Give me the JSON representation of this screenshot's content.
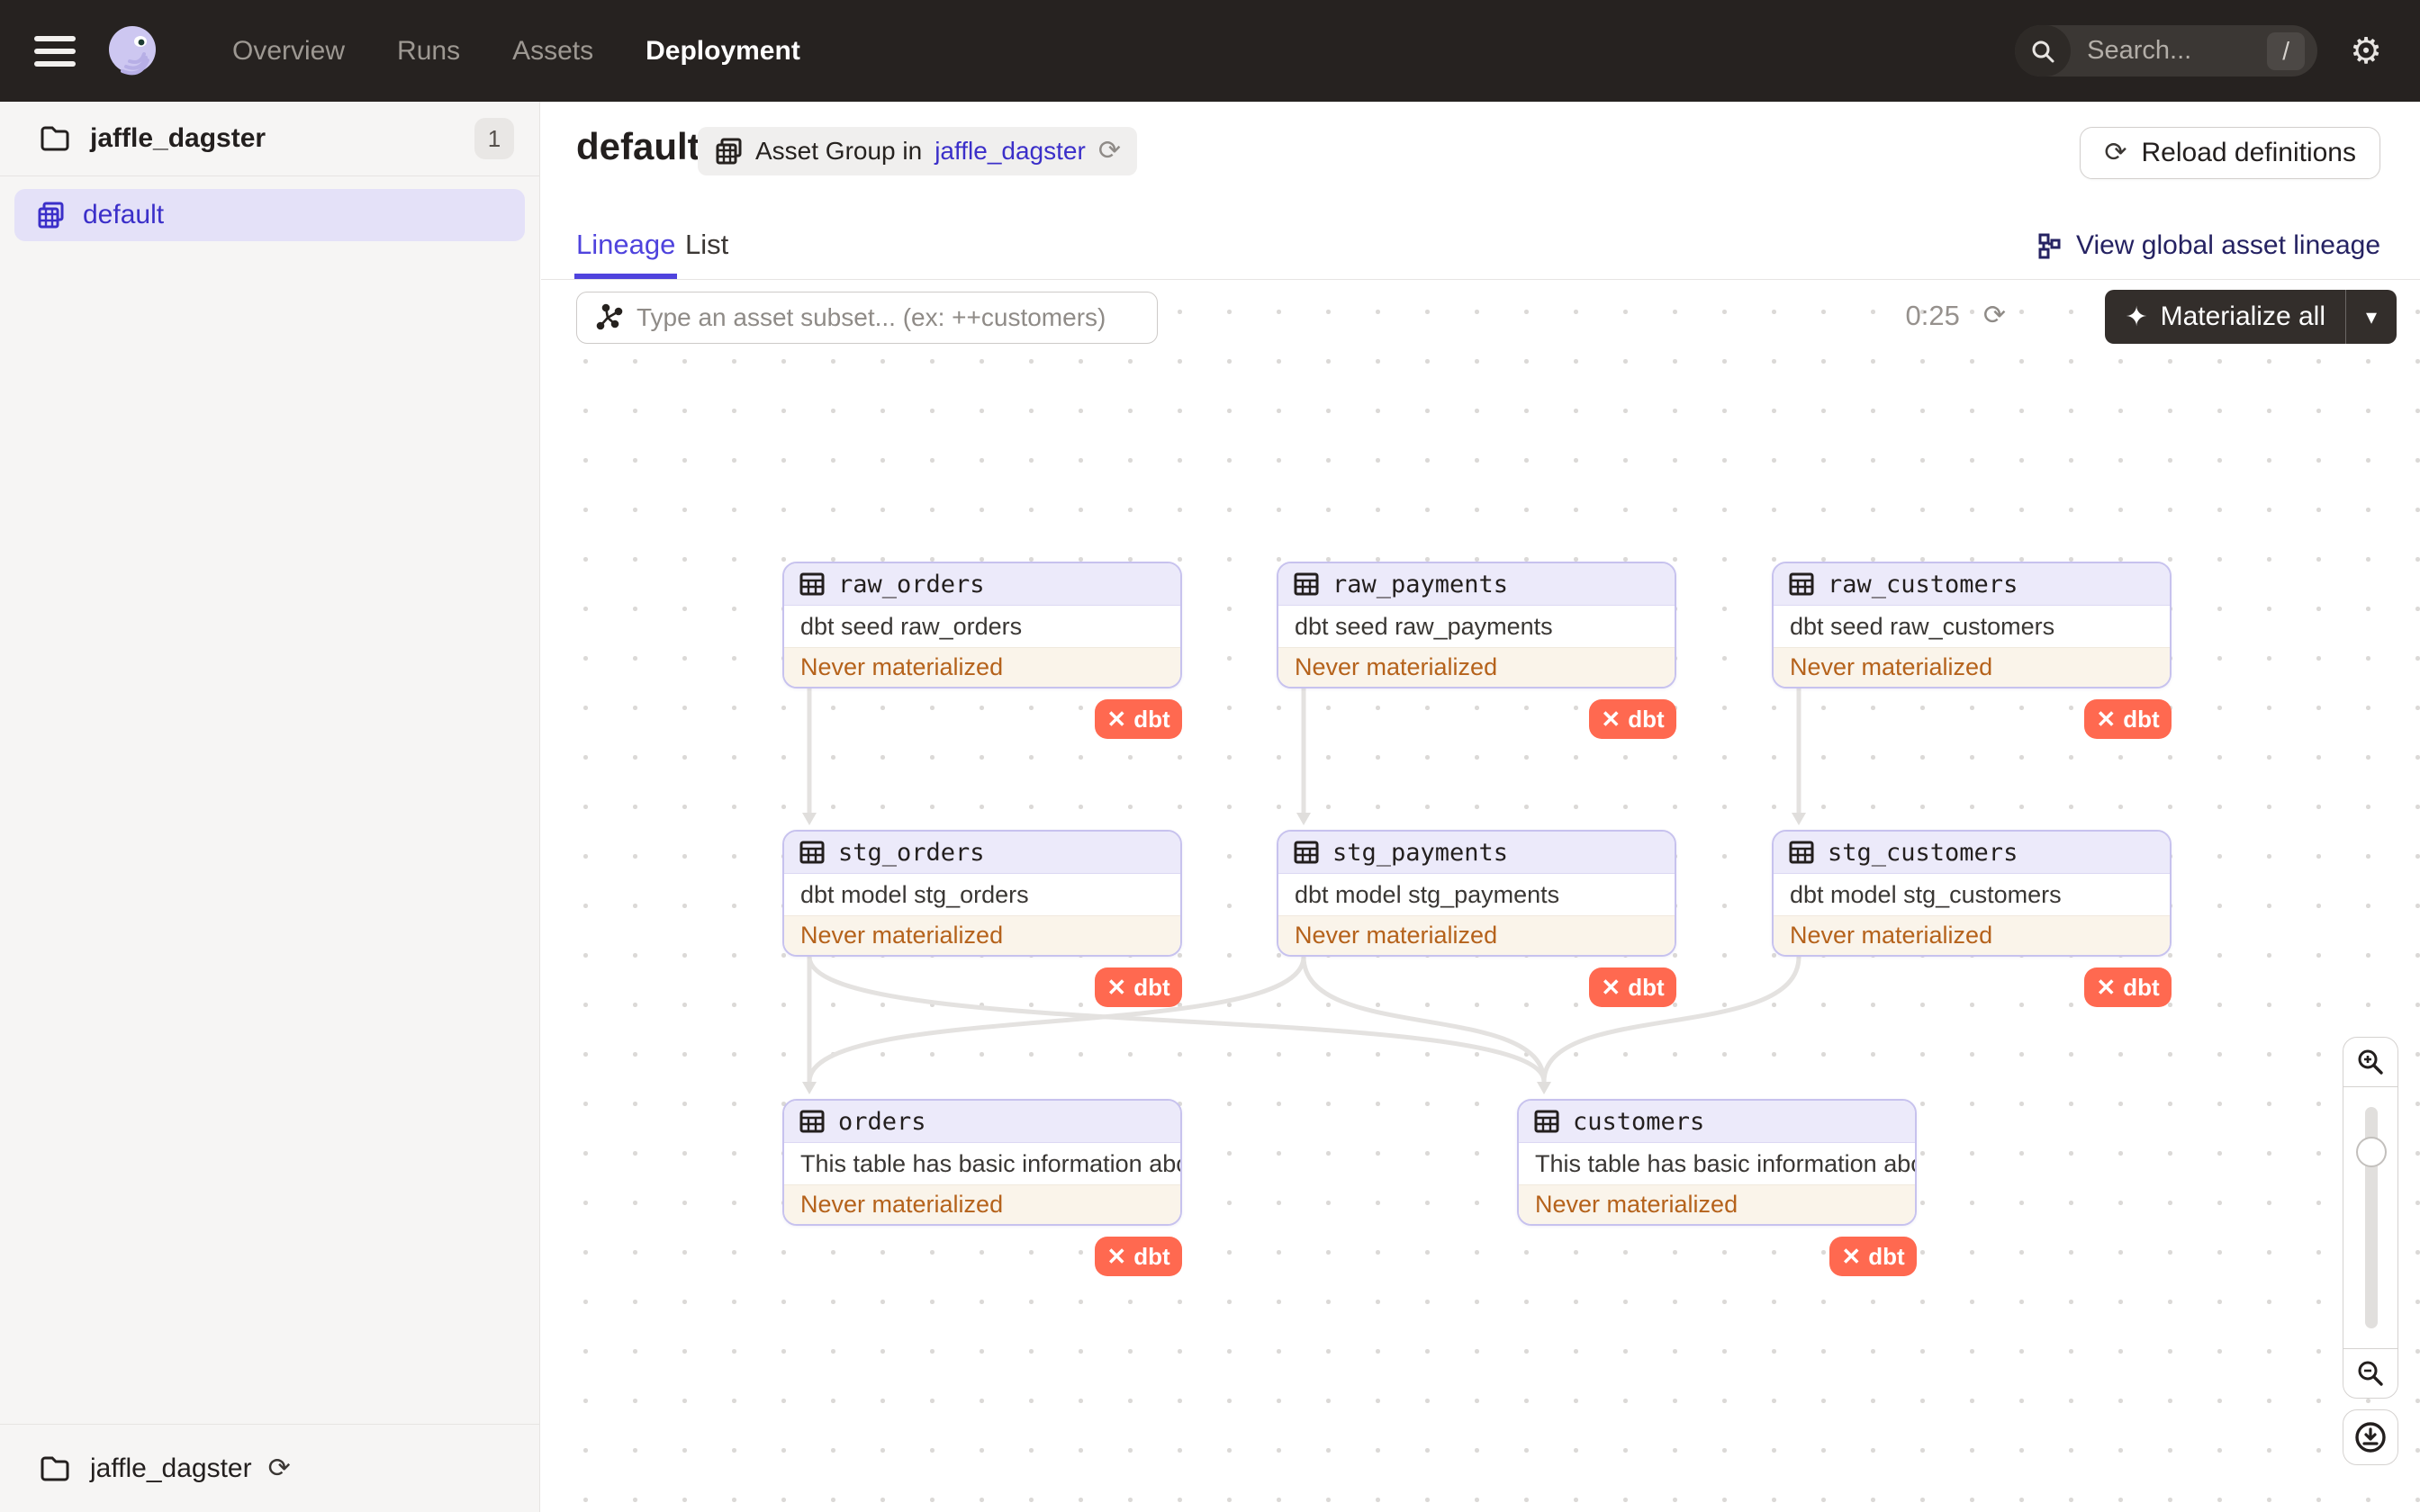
{
  "nav": {
    "items": [
      {
        "label": "Overview",
        "active": false
      },
      {
        "label": "Runs",
        "active": false
      },
      {
        "label": "Assets",
        "active": false
      },
      {
        "label": "Deployment",
        "active": true
      }
    ],
    "search_placeholder": "Search...",
    "search_shortcut": "/"
  },
  "sidebar": {
    "project_label": "jaffle_dagster",
    "project_count": "1",
    "selected_group": "default",
    "footer_label": "jaffle_dagster"
  },
  "header": {
    "title": "default",
    "tag_prefix": "Asset Group in",
    "tag_link": "jaffle_dagster",
    "reload_button": "Reload definitions"
  },
  "tabs": {
    "lineage": "Lineage",
    "list": "List",
    "global_lineage_link": "View global asset lineage"
  },
  "toolbar": {
    "filter_placeholder": "Type an asset subset... (ex: ++customers)",
    "timer": "0:25",
    "materialize_label": "Materialize all",
    "materialize_sparkle": "✦",
    "caret": "▾"
  },
  "graph": {
    "badge_label": "dbt",
    "status_label": "Never materialized",
    "nodes": [
      {
        "id": "raw_orders",
        "title": "raw_orders",
        "description": "dbt seed raw_orders",
        "status": "Never materialized"
      },
      {
        "id": "raw_payments",
        "title": "raw_payments",
        "description": "dbt seed raw_payments",
        "status": "Never materialized"
      },
      {
        "id": "raw_customers",
        "title": "raw_customers",
        "description": "dbt seed raw_customers",
        "status": "Never materialized"
      },
      {
        "id": "stg_orders",
        "title": "stg_orders",
        "description": "dbt model stg_orders",
        "status": "Never materialized"
      },
      {
        "id": "stg_payments",
        "title": "stg_payments",
        "description": "dbt model stg_payments",
        "status": "Never materialized"
      },
      {
        "id": "stg_customers",
        "title": "stg_customers",
        "description": "dbt model stg_customers",
        "status": "Never materialized"
      },
      {
        "id": "orders",
        "title": "orders",
        "description": "This table has basic information about ...",
        "status": "Never materialized"
      },
      {
        "id": "customers",
        "title": "customers",
        "description": "This table has basic information about ...",
        "status": "Never materialized"
      }
    ],
    "edges": [
      [
        "raw_orders",
        "stg_orders"
      ],
      [
        "raw_payments",
        "stg_payments"
      ],
      [
        "raw_customers",
        "stg_customers"
      ],
      [
        "stg_orders",
        "orders"
      ],
      [
        "stg_orders",
        "customers"
      ],
      [
        "stg_payments",
        "orders"
      ],
      [
        "stg_payments",
        "customers"
      ],
      [
        "stg_customers",
        "customers"
      ]
    ]
  },
  "colors": {
    "accent": "#4f43dd",
    "link": "#3b2fc9",
    "nav_bg": "#262220",
    "dbt_badge": "#ff6950",
    "status_text": "#b5621b",
    "status_bg": "#faf4ea",
    "node_border": "#c7c2ee",
    "node_header_bg": "#eceafa",
    "edge": "#e4e2e0"
  }
}
